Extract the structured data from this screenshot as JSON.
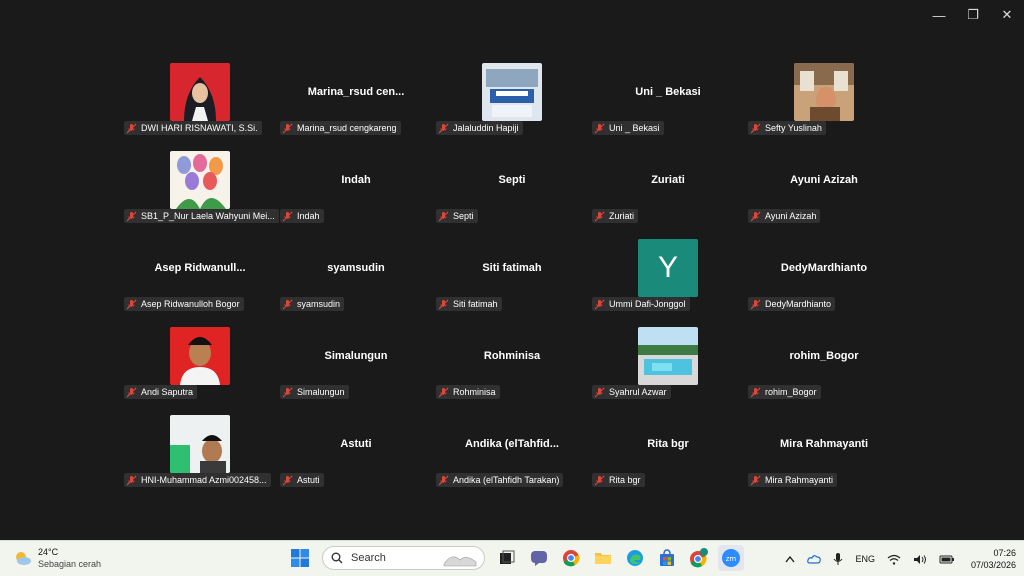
{
  "window": {
    "minimize": "—",
    "restore": "❐",
    "close": "✕"
  },
  "participants": [
    {
      "big_name": "",
      "label": "DWI HARI RISNAWATI, S.Si.",
      "avatar": "photo-hijab"
    },
    {
      "big_name": "Marina_rsud  cen...",
      "label": "Marina_rsud cengkareng",
      "avatar": ""
    },
    {
      "big_name": "",
      "label": "Jalaluddin Hapiji",
      "avatar": "photo-meeting"
    },
    {
      "big_name": "Uni _ Bekasi",
      "label": "Uni _ Bekasi",
      "avatar": ""
    },
    {
      "big_name": "",
      "label": "Sefty Yuslinah",
      "avatar": "photo-room"
    },
    {
      "big_name": "",
      "label": "SB1_P_Nur Laela Wahyuni Mei...",
      "avatar": "photo-tulips"
    },
    {
      "big_name": "Indah",
      "label": "Indah",
      "avatar": ""
    },
    {
      "big_name": "Septi",
      "label": "Septi",
      "avatar": ""
    },
    {
      "big_name": "Zuriati",
      "label": "Zuriati",
      "avatar": ""
    },
    {
      "big_name": "Ayuni Azizah",
      "label": "Ayuni Azizah",
      "avatar": ""
    },
    {
      "big_name": "Asep  Ridwanull...",
      "label": "Asep Ridwanulloh Bogor",
      "avatar": ""
    },
    {
      "big_name": "syamsudin",
      "label": "syamsudin",
      "avatar": ""
    },
    {
      "big_name": "Siti fatimah",
      "label": "Siti fatimah",
      "avatar": ""
    },
    {
      "big_name": "",
      "label": "Ummi Dafi-Jonggol",
      "avatar": "letter-Y"
    },
    {
      "big_name": "DedyMardhianto",
      "label": "DedyMardhianto",
      "avatar": ""
    },
    {
      "big_name": "",
      "label": "Andi Saputra",
      "avatar": "photo-man-red"
    },
    {
      "big_name": "Simalungun",
      "label": "Simalungun",
      "avatar": ""
    },
    {
      "big_name": "Rohminisa",
      "label": "Rohminisa",
      "avatar": ""
    },
    {
      "big_name": "",
      "label": "Syahrul Azwar",
      "avatar": "photo-pool"
    },
    {
      "big_name": "rohim_Bogor",
      "label": "rohim_Bogor",
      "avatar": ""
    },
    {
      "big_name": "",
      "label": "HNI-Muhammad Azmi002458...",
      "avatar": "photo-selfie"
    },
    {
      "big_name": "Astuti",
      "label": "Astuti",
      "avatar": ""
    },
    {
      "big_name": "Andika  (elTahfid...",
      "label": "Andika (elTahfidh Tarakan)",
      "avatar": ""
    },
    {
      "big_name": "Rita bgr",
      "label": "Rita bgr",
      "avatar": ""
    },
    {
      "big_name": "Mira Rahmayanti",
      "label": "Mira Rahmayanti",
      "avatar": ""
    }
  ],
  "letter_avatar": {
    "letter": "Y",
    "color": "#1a8a7a"
  },
  "taskbar": {
    "weather_temp": "24°C",
    "weather_cond": "Sebagian cerah",
    "search_placeholder": "Search",
    "language": "ENG",
    "time": "07:26",
    "date": "07/03/2026"
  },
  "colors": {
    "mic_off": "#e0453a",
    "tile_label_bg": "#323232",
    "background": "#1a1a1a"
  }
}
